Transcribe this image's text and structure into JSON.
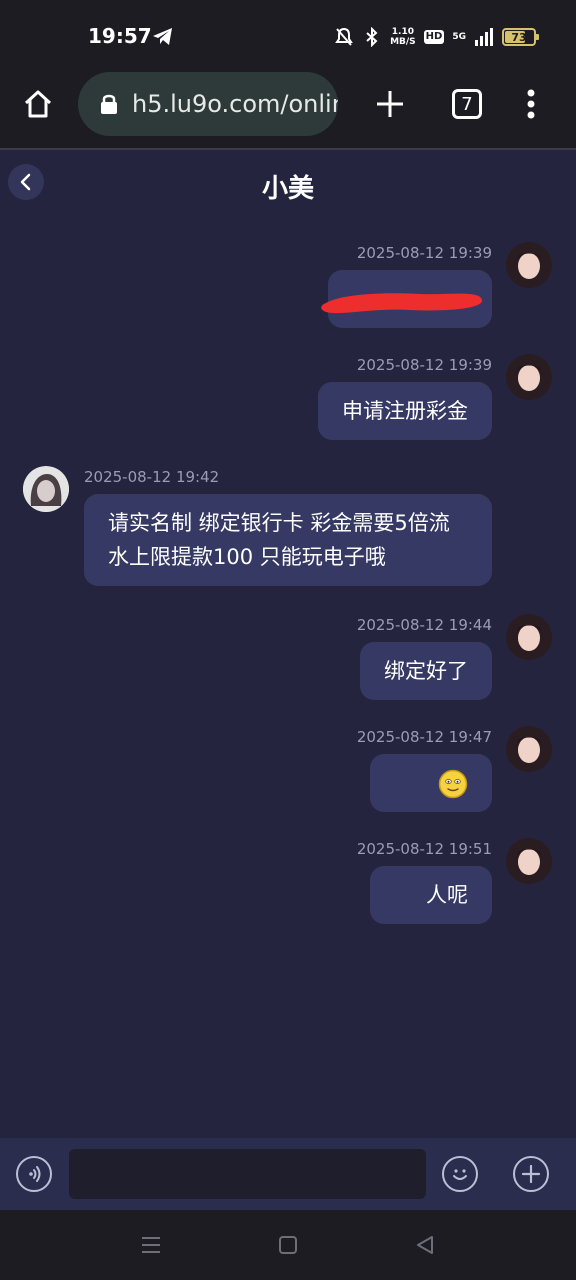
{
  "status_bar": {
    "time": "19:57",
    "net_speed_value": "1.10",
    "net_speed_unit": "MB/S",
    "hd_label": "HD",
    "signal_label": "5G",
    "battery_level": "73",
    "battery_fraction": 0.73
  },
  "browser": {
    "url": "h5.lu9o.com/onlir",
    "tab_count": "7"
  },
  "chat": {
    "title": "小美",
    "messages": [
      {
        "side": "self",
        "time": "2025-08-12 19:39",
        "text": "",
        "redacted": true
      },
      {
        "side": "self",
        "time": "2025-08-12 19:39",
        "text": "申请注册彩金"
      },
      {
        "side": "other",
        "time": "2025-08-12 19:42",
        "text_line1": "请实名制 绑定银行卡 彩金需要5倍流",
        "text_line2": "水上限提款100 只能玩电子哦"
      },
      {
        "side": "self",
        "time": "2025-08-12 19:44",
        "text": "绑定好了"
      },
      {
        "side": "self",
        "time": "2025-08-12 19:47",
        "emoji": "smile-emoji"
      },
      {
        "side": "self",
        "time": "2025-08-12 19:51",
        "text": "人呢"
      }
    ]
  },
  "colors": {
    "background": "#25243f",
    "bubble": "#363963",
    "timestamp": "#9a9cb5",
    "system_bar": "#1c1c22",
    "input_bar": "#2a2d4d",
    "redaction": "#ee2d2d"
  },
  "icons": {
    "home": "home-icon",
    "lock": "lock-icon",
    "new_tab": "plus-icon",
    "menu": "more-vert-icon",
    "back": "chevron-left-icon",
    "voice": "voice-icon",
    "emoji": "emoji-icon",
    "more": "plus-circle-icon"
  }
}
